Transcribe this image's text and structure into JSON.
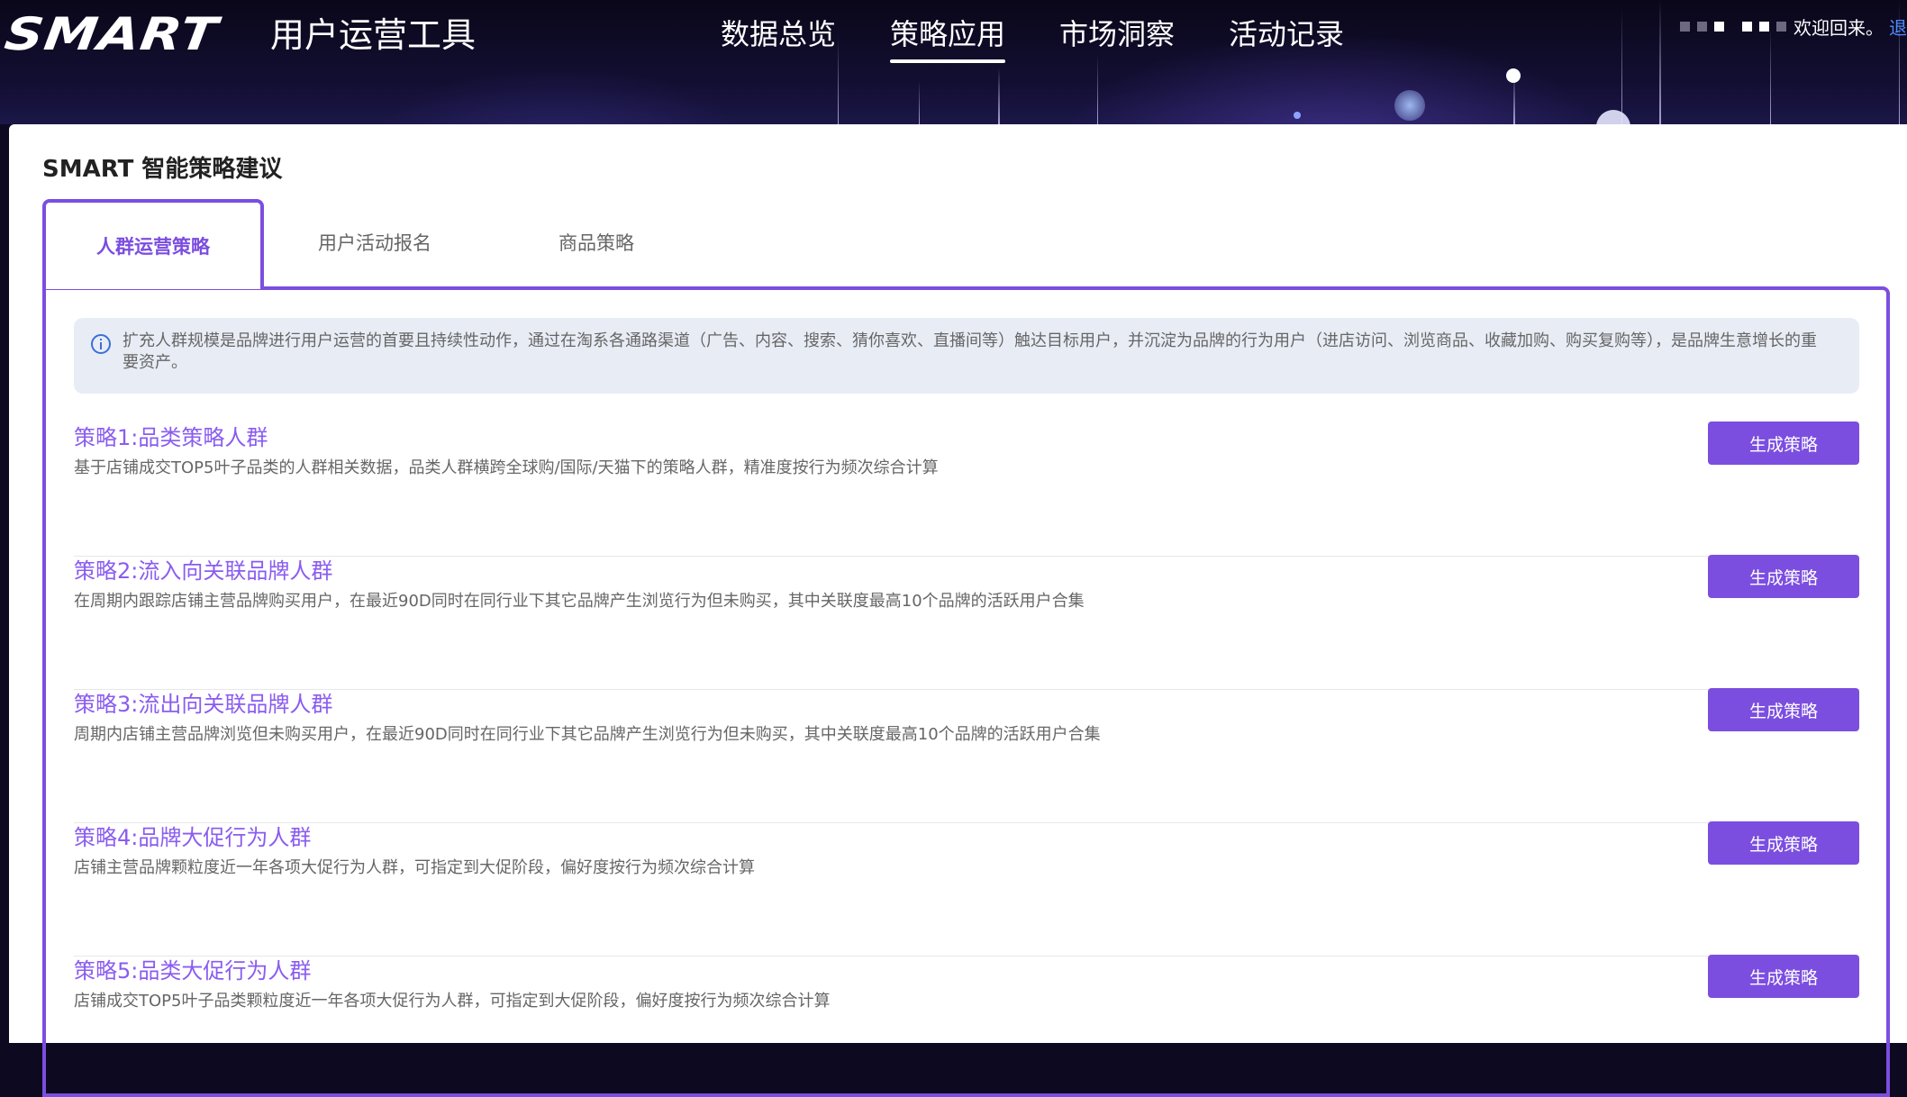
{
  "header": {
    "logo_text": "SMART",
    "app_title": "用户运营工具",
    "nav": [
      {
        "label": "数据总览",
        "active": false
      },
      {
        "label": "策略应用",
        "active": true
      },
      {
        "label": "市场洞察",
        "active": false
      },
      {
        "label": "活动记录",
        "active": false
      }
    ],
    "user": {
      "welcome": "欢迎回来。",
      "logout": "退"
    }
  },
  "page": {
    "title": "SMART 智能策略建议",
    "tabs": [
      {
        "label": "人群运营策略",
        "active": true
      },
      {
        "label": "用户活动报名",
        "active": false
      },
      {
        "label": "商品策略",
        "active": false
      }
    ],
    "notice": "扩充人群规模是品牌进行用户运营的首要且持续性动作，通过在淘系各通路渠道（广告、内容、搜索、猜你喜欢、直播间等）触达目标用户，并沉淀为品牌的行为用户（进店访问、浏览商品、收藏加购、购买复购等），是品牌生意增长的重要资产。",
    "strategies": [
      {
        "name": "策略1:品类策略人群",
        "description": "基于店铺成交TOP5叶子品类的人群相关数据，品类人群横跨全球购/国际/天猫下的策略人群，精准度按行为频次综合计算",
        "button": "生成策略"
      },
      {
        "name": "策略2:流入向关联品牌人群",
        "description": "在周期内跟踪店铺主营品牌购买用户，在最近90D同时在同行业下其它品牌产生浏览行为但未购买，其中关联度最高10个品牌的活跃用户合集",
        "button": "生成策略"
      },
      {
        "name": "策略3:流出向关联品牌人群",
        "description": "周期内店铺主营品牌浏览但未购买用户，在最近90D同时在同行业下其它品牌产生浏览行为但未购买，其中关联度最高10个品牌的活跃用户合集",
        "button": "生成策略"
      },
      {
        "name": "策略4:品牌大促行为人群",
        "description": "店铺主营品牌颗粒度近一年各项大促行为人群，可指定到大促阶段，偏好度按行为频次综合计算",
        "button": "生成策略"
      },
      {
        "name": "策略5:品类大促行为人群",
        "description": "店铺成交TOP5叶子品类颗粒度近一年各项大促行为人群，可指定到大促阶段，偏好度按行为频次综合计算",
        "button": "生成策略"
      }
    ]
  },
  "colors": {
    "accent": "#7b4ee0",
    "strategy_title": "#8a5cf0",
    "notice_bg": "#e8ecf5",
    "header_bg": "#0c0920",
    "logout_link": "#4f8bff"
  },
  "icons": [
    "info-icon"
  ]
}
